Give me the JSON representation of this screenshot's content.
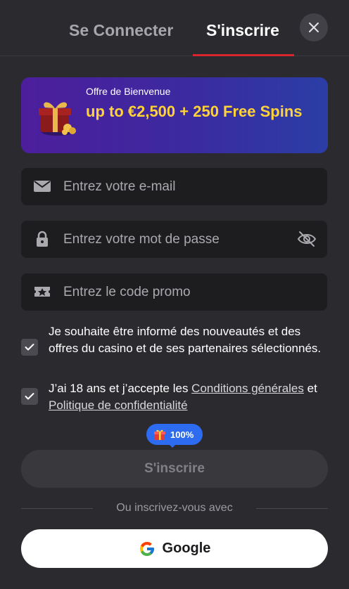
{
  "tabs": {
    "login": "Se Connecter",
    "register": "S'inscrire"
  },
  "promo": {
    "label": "Offre de Bienvenue",
    "offer": "up to €2,500 + 250 Free Spins"
  },
  "fields": {
    "email_placeholder": "Entrez votre e-mail",
    "password_placeholder": "Entrez votre mot de passe",
    "promo_placeholder": "Entrez le code promo"
  },
  "checks": {
    "newsletter": "Je souhaite être informé des nouveautés et des offres du casino et de ses partenaires sélectionnés.",
    "terms_prefix": "J’ai 18 ans et j’accepte les ",
    "terms_link": "Conditions générales",
    "terms_and": " et ",
    "privacy_link": "Politique de confidentialité"
  },
  "badge": {
    "percent": "100%"
  },
  "submit_label": "S'inscrire",
  "divider_text": "Ou inscrivez-vous avec",
  "google_label": "Google",
  "icons": {
    "close": "close-icon",
    "gift": "gift-icon",
    "email": "envelope-icon",
    "password": "lock-icon",
    "visibility": "eye-slash-icon",
    "promo": "ticket-icon",
    "check": "check-icon",
    "google": "google-logo-icon"
  },
  "colors": {
    "accent": "#d9262e",
    "promo_text": "#ffd23a",
    "badge": "#2d6cf0"
  }
}
